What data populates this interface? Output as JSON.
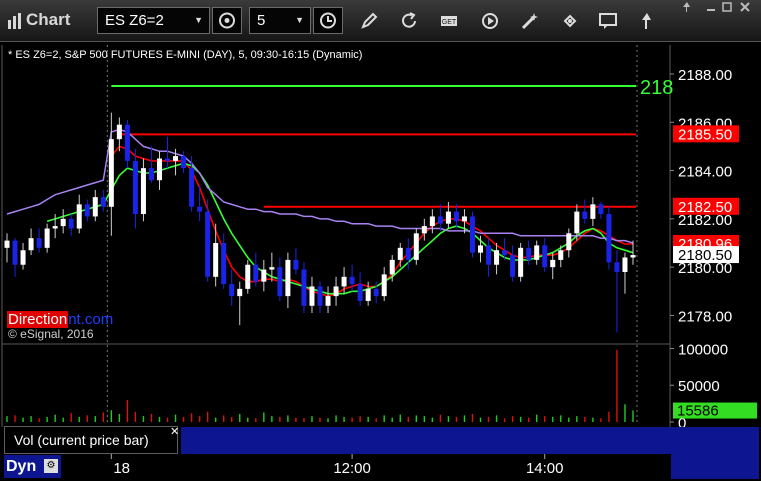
{
  "app": {
    "title": "Chart"
  },
  "toolbar": {
    "symbol": "ES Z6=2",
    "interval": "5",
    "icons": [
      "link-icon",
      "clock-icon",
      "pencil-icon",
      "refresh-icon",
      "get-icon",
      "play-icon",
      "wand-icon",
      "chat-icon",
      "pin-icon"
    ]
  },
  "chart_header": "* ES Z6=2, S&P 500 FUTURES E-MINI (DAY), 5, 09:30-16:15 (Dynamic)",
  "copyright": "© eSignal, 2016",
  "logo": {
    "part1": "Direction",
    "part2": "nt.com"
  },
  "volume_tab": "Vol (current price bar)",
  "dyn_label": "Dyn",
  "colors": {
    "up": "#ffffff",
    "down": "#1a24e8",
    "ema_red": "#ff0000",
    "ema_green": "#33ff33",
    "vwap": "#a882f0",
    "hline_red": "#ff0000",
    "hline_green": "#33ff33",
    "accent_blue": "#0d1690"
  },
  "chart_data": {
    "type": "candlestick",
    "title": "* ES Z6=2, S&P 500 FUTURES E-MINI (DAY), 5, 09:30-16:15 (Dynamic)",
    "price_axis": {
      "ticks": [
        2178.0,
        2180.0,
        2182.0,
        2184.0,
        2186.0,
        2188.0
      ],
      "ylim": [
        2176.9,
        2189.2
      ]
    },
    "volume_axis": {
      "ticks": [
        "0",
        "50000",
        "100000"
      ],
      "ylim": [
        0,
        102000
      ]
    },
    "time_axis": {
      "ticks": [
        {
          "label": "18",
          "index": 13
        },
        {
          "label": "12:00",
          "index": 43
        },
        {
          "label": "14:00",
          "index": 67
        }
      ]
    },
    "price_labels": [
      {
        "text": "2185.50",
        "value": 2185.5,
        "bg": "#ff0000",
        "fg": "#ffffff"
      },
      {
        "text": "2182.50",
        "value": 2182.5,
        "bg": "#ff0000",
        "fg": "#ffffff"
      },
      {
        "text": "2180.96",
        "value": 2180.96,
        "bg": "#ff0000",
        "fg": "#ffffff"
      },
      {
        "text": "2180.50",
        "value": 2180.5,
        "bg": "#ffffff",
        "fg": "#000000"
      }
    ],
    "volume_label": {
      "text": "15586",
      "value": 15586,
      "bg": "#33dd22",
      "fg": "#000000"
    },
    "horizontal_lines": [
      {
        "value": 2187.5,
        "color": "green",
        "label": "218",
        "from_index": 13
      },
      {
        "value": 2185.5,
        "color": "red",
        "from_index": 14
      },
      {
        "value": 2182.5,
        "color": "red",
        "from_index": 32
      }
    ],
    "candles": [
      [
        2180.8,
        2181.4,
        2180.2,
        2181.1
      ],
      [
        2181.1,
        2181.2,
        2179.6,
        2180.1
      ],
      [
        2180.1,
        2181.0,
        2179.9,
        2180.7
      ],
      [
        2180.7,
        2181.6,
        2180.5,
        2181.2
      ],
      [
        2181.2,
        2181.6,
        2180.6,
        2180.8
      ],
      [
        2180.8,
        2181.8,
        2180.6,
        2181.6
      ],
      [
        2181.6,
        2182.2,
        2181.2,
        2181.7
      ],
      [
        2181.7,
        2182.4,
        2181.4,
        2182.0
      ],
      [
        2182.0,
        2182.2,
        2181.3,
        2181.6
      ],
      [
        2181.6,
        2183.0,
        2181.4,
        2182.6
      ],
      [
        2182.6,
        2182.8,
        2181.9,
        2182.1
      ],
      [
        2182.1,
        2183.2,
        2181.9,
        2182.9
      ],
      [
        2182.9,
        2183.2,
        2182.3,
        2182.5
      ],
      [
        2182.5,
        2186.4,
        2181.3,
        2185.3
      ],
      [
        2185.3,
        2186.2,
        2184.8,
        2185.9
      ],
      [
        2185.9,
        2186.1,
        2184.1,
        2184.4
      ],
      [
        2184.4,
        2184.9,
        2181.6,
        2182.2
      ],
      [
        2182.2,
        2184.5,
        2181.9,
        2184.1
      ],
      [
        2184.1,
        2185.0,
        2183.5,
        2183.6
      ],
      [
        2183.6,
        2184.8,
        2183.2,
        2184.5
      ],
      [
        2184.5,
        2185.4,
        2184.1,
        2184.4
      ],
      [
        2184.4,
        2184.9,
        2183.8,
        2184.6
      ],
      [
        2184.6,
        2184.8,
        2183.9,
        2184.1
      ],
      [
        2184.1,
        2184.6,
        2182.3,
        2182.5
      ],
      [
        2182.5,
        2183.4,
        2181.9,
        2182.3
      ],
      [
        2182.3,
        2182.8,
        2179.4,
        2179.6
      ],
      [
        2179.6,
        2181.8,
        2179.2,
        2181.0
      ],
      [
        2181.0,
        2181.4,
        2179.1,
        2179.3
      ],
      [
        2179.3,
        2179.9,
        2178.4,
        2178.8
      ],
      [
        2178.8,
        2179.4,
        2177.6,
        2179.1
      ],
      [
        2179.1,
        2180.3,
        2178.9,
        2180.1
      ],
      [
        2180.1,
        2180.6,
        2179.2,
        2179.4
      ],
      [
        2179.4,
        2180.3,
        2179.0,
        2179.9
      ],
      [
        2179.9,
        2180.6,
        2179.4,
        2180.0
      ],
      [
        2180.0,
        2180.4,
        2178.6,
        2178.8
      ],
      [
        2178.8,
        2180.6,
        2178.3,
        2180.3
      ],
      [
        2180.3,
        2180.8,
        2179.7,
        2179.9
      ],
      [
        2179.9,
        2180.2,
        2178.1,
        2178.4
      ],
      [
        2178.4,
        2179.6,
        2178.1,
        2179.2
      ],
      [
        2179.2,
        2179.4,
        2178.1,
        2178.4
      ],
      [
        2178.4,
        2179.2,
        2178.1,
        2178.8
      ],
      [
        2178.8,
        2179.6,
        2178.4,
        2179.2
      ],
      [
        2179.2,
        2180.0,
        2178.9,
        2179.6
      ],
      [
        2179.6,
        2180.1,
        2179.0,
        2179.3
      ],
      [
        2179.3,
        2179.8,
        2178.4,
        2178.6
      ],
      [
        2178.6,
        2179.4,
        2178.4,
        2179.1
      ],
      [
        2179.1,
        2179.4,
        2178.5,
        2178.8
      ],
      [
        2178.8,
        2180.0,
        2178.6,
        2179.7
      ],
      [
        2179.7,
        2180.5,
        2179.4,
        2180.3
      ],
      [
        2180.3,
        2181.0,
        2180.0,
        2180.8
      ],
      [
        2180.8,
        2181.2,
        2179.9,
        2180.3
      ],
      [
        2180.3,
        2181.6,
        2180.1,
        2181.4
      ],
      [
        2181.4,
        2182.0,
        2181.1,
        2181.7
      ],
      [
        2181.7,
        2182.4,
        2181.4,
        2182.1
      ],
      [
        2182.1,
        2182.6,
        2181.5,
        2181.8
      ],
      [
        2181.8,
        2182.7,
        2181.6,
        2182.3
      ],
      [
        2182.3,
        2182.6,
        2181.6,
        2181.9
      ],
      [
        2181.9,
        2182.4,
        2181.4,
        2182.1
      ],
      [
        2182.1,
        2182.3,
        2180.4,
        2180.6
      ],
      [
        2180.6,
        2181.3,
        2180.2,
        2180.9
      ],
      [
        2180.9,
        2181.2,
        2179.6,
        2180.1
      ],
      [
        2180.1,
        2181.0,
        2179.7,
        2180.7
      ],
      [
        2180.7,
        2181.2,
        2180.3,
        2180.5
      ],
      [
        2180.5,
        2180.9,
        2179.4,
        2179.6
      ],
      [
        2179.6,
        2181.0,
        2179.4,
        2180.8
      ],
      [
        2180.8,
        2181.1,
        2180.1,
        2180.3
      ],
      [
        2180.3,
        2181.1,
        2180.1,
        2180.9
      ],
      [
        2180.9,
        2181.2,
        2179.8,
        2180.0
      ],
      [
        2180.0,
        2180.6,
        2179.5,
        2180.3
      ],
      [
        2180.3,
        2180.9,
        2180.0,
        2180.7
      ],
      [
        2180.7,
        2181.6,
        2180.4,
        2181.4
      ],
      [
        2181.4,
        2182.6,
        2181.1,
        2182.3
      ],
      [
        2182.3,
        2182.8,
        2181.8,
        2182.0
      ],
      [
        2182.0,
        2182.9,
        2181.7,
        2182.6
      ],
      [
        2182.6,
        2182.7,
        2182.0,
        2182.2
      ],
      [
        2182.2,
        2182.5,
        2179.9,
        2180.2
      ],
      [
        2180.2,
        2180.7,
        2177.3,
        2179.8
      ],
      [
        2179.8,
        2180.6,
        2178.9,
        2180.4
      ],
      [
        2180.4,
        2181.1,
        2180.1,
        2180.5
      ]
    ],
    "series": [
      {
        "name": "",
        "color": "red",
        "values": [
          null,
          null,
          null,
          null,
          null,
          null,
          null,
          null,
          null,
          null,
          null,
          null,
          null,
          2184.6,
          2185.0,
          2184.9,
          2184.6,
          2184.5,
          2184.4,
          2184.4,
          2184.4,
          2184.4,
          2184.4,
          2184.0,
          2183.3,
          2182.4,
          2181.5,
          2180.7,
          2180.0,
          2179.6,
          2179.4,
          2179.4,
          2179.5,
          2179.5,
          2179.4,
          2179.5,
          2179.4,
          2179.2,
          2179.0,
          2178.9,
          2178.8,
          2178.9,
          2179.1,
          2179.2,
          2179.3,
          2179.2,
          2179.2,
          2179.4,
          2179.7,
          2180.2,
          2180.6,
          2181.0,
          2181.4,
          2181.7,
          2181.9,
          2182.0,
          2182.0,
          2181.9,
          2181.7,
          2181.5,
          2181.2,
          2180.9,
          2180.7,
          2180.5,
          2180.4,
          2180.4,
          2180.5,
          2180.5,
          2180.5,
          2180.6,
          2180.8,
          2181.1,
          2181.4,
          2181.6,
          2181.5,
          2181.3,
          2181.1,
          2180.96,
          2180.96
        ]
      },
      {
        "name": "",
        "color": "green",
        "values": [
          null,
          null,
          null,
          null,
          null,
          2181.9,
          2182.0,
          2182.1,
          2182.2,
          2182.3,
          2182.4,
          2182.5,
          2182.6,
          2183.2,
          2183.8,
          2184.1,
          2184.0,
          2183.9,
          2183.9,
          2184.0,
          2184.1,
          2184.2,
          2184.3,
          2184.2,
          2183.9,
          2183.4,
          2182.7,
          2182.0,
          2181.4,
          2180.9,
          2180.4,
          2180.0,
          2179.8,
          2179.6,
          2179.5,
          2179.4,
          2179.3,
          2179.2,
          2179.1,
          2179.0,
          2178.9,
          2178.9,
          2178.9,
          2179.0,
          2179.0,
          2179.1,
          2179.2,
          2179.4,
          2179.6,
          2179.9,
          2180.2,
          2180.5,
          2180.8,
          2181.1,
          2181.4,
          2181.6,
          2181.7,
          2181.6,
          2181.4,
          2181.1,
          2180.8,
          2180.6,
          2180.4,
          2180.3,
          2180.3,
          2180.3,
          2180.4,
          2180.5,
          2180.6,
          2180.8,
          2181.0,
          2181.3,
          2181.5,
          2181.6,
          2181.4,
          2181.0,
          2180.8,
          2180.7,
          2180.6
        ]
      },
      {
        "name": "",
        "color": "green",
        "values": [
          2182.2,
          2182.3,
          2182.4,
          2182.5,
          2182.6,
          2182.8,
          2183.0,
          2183.1,
          2183.2,
          2183.3,
          2183.4,
          2183.5,
          2183.6,
          2185.6,
          2185.7,
          2185.6,
          2185.3,
          2185.0,
          2184.9,
          2184.8,
          2184.8,
          2184.7,
          2184.6,
          2184.3,
          2183.9,
          2183.3,
          2183.0,
          2182.7,
          2182.6,
          2182.5,
          2182.4,
          2182.4,
          2182.3,
          2182.3,
          2182.2,
          2182.2,
          2182.2,
          2182.1,
          2182.1,
          2182.0,
          2182.0,
          2181.9,
          2181.9,
          2181.8,
          2181.8,
          2181.8,
          2181.7,
          2181.7,
          2181.7,
          2181.6,
          2181.6,
          2181.6,
          2181.6,
          2181.6,
          2181.6,
          2181.5,
          2181.5,
          2181.5,
          2181.5,
          2181.4,
          2181.4,
          2181.4,
          2181.4,
          2181.4,
          2181.3,
          2181.3,
          2181.3,
          2181.3,
          2181.3,
          2181.3,
          2181.3,
          2181.3,
          2181.3,
          2181.3,
          2181.2,
          2181.2,
          2181.1,
          2181.1,
          2181.0
        ]
      }
    ],
    "volume": [
      8000,
      9000,
      6000,
      8000,
      5000,
      7000,
      10000,
      6000,
      12000,
      7000,
      9000,
      8000,
      13000,
      16000,
      11000,
      30000,
      14000,
      8000,
      11000,
      7000,
      6000,
      10000,
      7000,
      12000,
      8000,
      14000,
      6000,
      9000,
      7000,
      11000,
      6000,
      5000,
      13000,
      8000,
      7000,
      9000,
      6000,
      5000,
      8000,
      6000,
      5000,
      9000,
      7000,
      6000,
      8000,
      7000,
      5000,
      9000,
      6000,
      10000,
      7000,
      9000,
      8000,
      6000,
      10000,
      8000,
      7000,
      9000,
      11000,
      6000,
      7000,
      9000,
      5000,
      8000,
      7000,
      6000,
      10000,
      8000,
      7000,
      9000,
      6000,
      8000,
      7000,
      6000,
      5000,
      14000,
      98000,
      24000,
      15586
    ]
  }
}
